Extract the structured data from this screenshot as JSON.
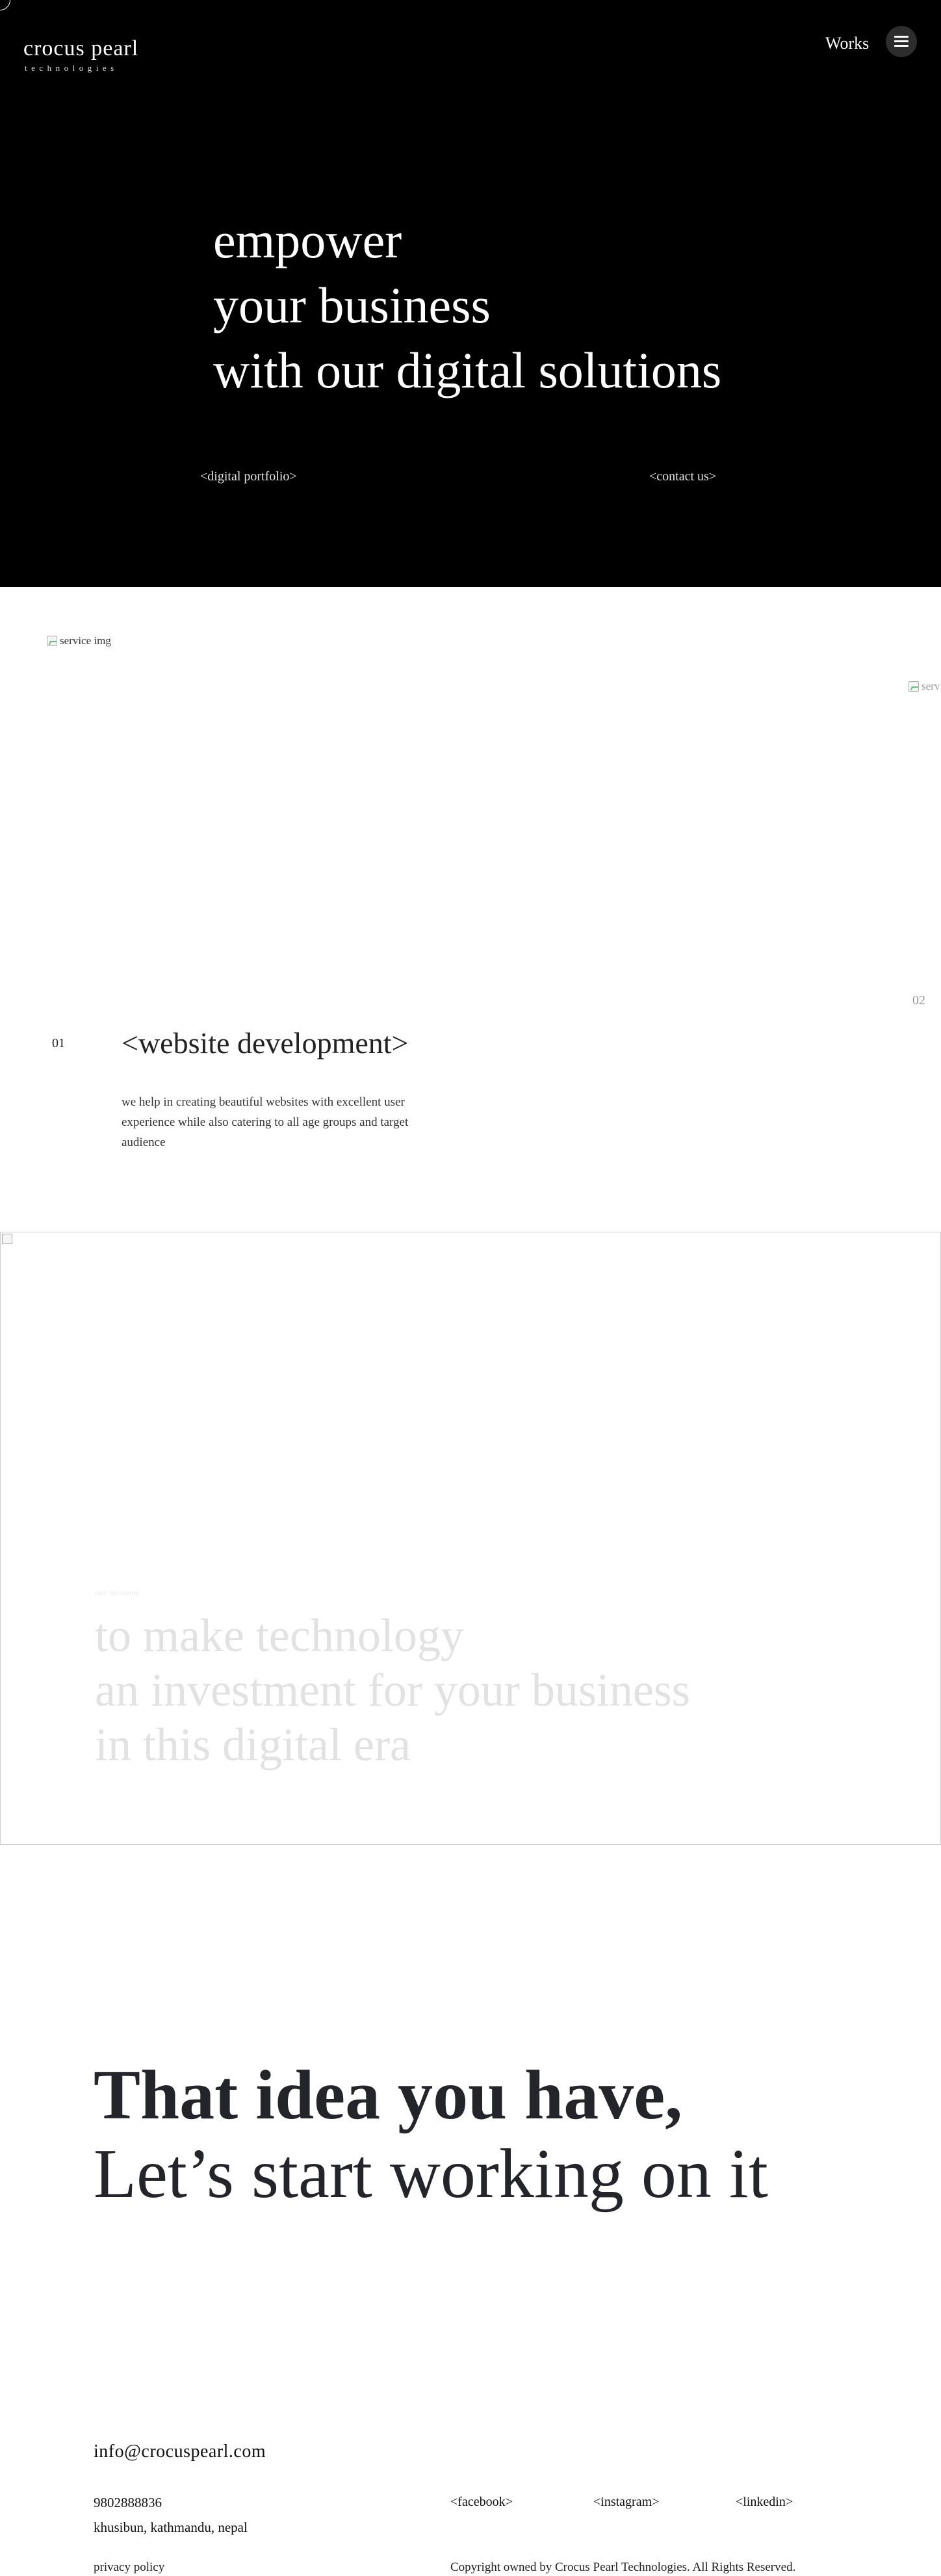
{
  "header": {
    "brand_name": "crocus pearl",
    "brand_sub": "technologies",
    "nav_works": "Works",
    "menu_icon": "hamburger-icon"
  },
  "hero": {
    "headline_lines": [
      "empower",
      "your business",
      "with our digital solutions"
    ],
    "portfolio_link": "<digital portfolio>",
    "contact_link": "<contact us>"
  },
  "services": {
    "img_alt_1": "service img",
    "img_alt_2": "serv",
    "number_current": "01",
    "number_next": "02",
    "title": "<website development>",
    "description": "we help in creating beautiful websites with excellent user experience while also catering to all age groups and target audience"
  },
  "mission": {
    "label": "our mission",
    "lines": [
      "to make technology",
      "an investment for your business",
      "in this digital era"
    ]
  },
  "cta": {
    "line1": "That idea you have,",
    "line2": "Let’s start working on it"
  },
  "footer": {
    "email": "info@crocuspearl.com",
    "phone": "9802888836",
    "address": "khusibun, kathmandu, nepal",
    "privacy": "privacy policy",
    "social": [
      "<facebook>",
      "<instagram>",
      "<linkedin>"
    ],
    "copyright": "Copyright owned by Crocus Pearl Technologies. All Rights Reserved."
  },
  "colors": {
    "hero_bg": "#000000",
    "text_dark": "#23252b",
    "mission_text": "#e2e2e2"
  }
}
